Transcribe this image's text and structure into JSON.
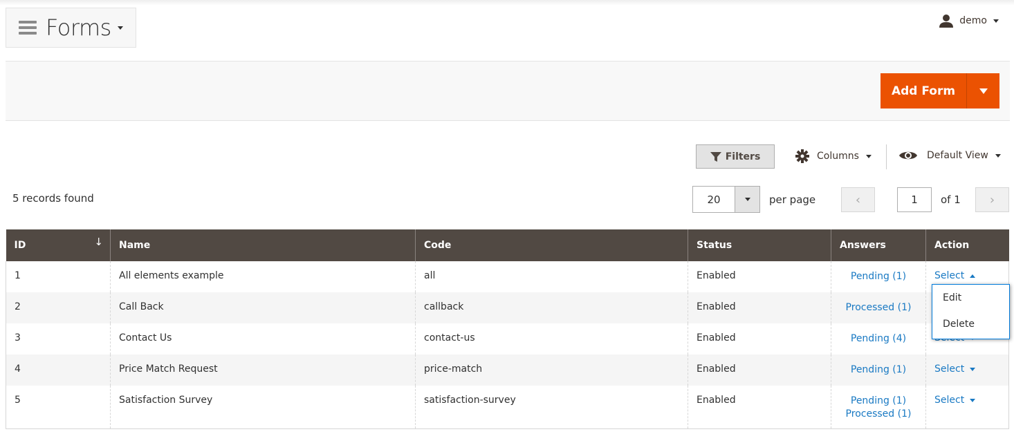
{
  "header": {
    "title": "Forms",
    "user": "demo"
  },
  "actions": {
    "add_label": "Add Form"
  },
  "toolbar": {
    "filters": "Filters",
    "columns": "Columns",
    "view": "Default View"
  },
  "grid": {
    "records_found": "5 records found",
    "per_page_value": "20",
    "per_page_label": "per page",
    "page": "1",
    "of_pages": "of 1",
    "columns": [
      "ID",
      "Name",
      "Code",
      "Status",
      "Answers",
      "Action"
    ],
    "sort_indicator": "↓",
    "rows": [
      {
        "id": "1",
        "name": "All elements example",
        "code": "all",
        "status": "Enabled",
        "answers": [
          "Pending (1)"
        ],
        "action": "Select",
        "open": true
      },
      {
        "id": "2",
        "name": "Call Back",
        "code": "callback",
        "status": "Enabled",
        "answers": [
          "Processed (1)"
        ],
        "action": "Select"
      },
      {
        "id": "3",
        "name": "Contact Us",
        "code": "contact-us",
        "status": "Enabled",
        "answers": [
          "Pending (4)"
        ],
        "action": "Select"
      },
      {
        "id": "4",
        "name": "Price Match Request",
        "code": "price-match",
        "status": "Enabled",
        "answers": [
          "Pending (1)"
        ],
        "action": "Select"
      },
      {
        "id": "5",
        "name": "Satisfaction Survey",
        "code": "satisfaction-survey",
        "status": "Enabled",
        "answers": [
          "Pending (1)",
          "Processed (1)"
        ],
        "action": "Select"
      }
    ],
    "action_menu": [
      "Edit",
      "Delete"
    ]
  },
  "colors": {
    "accent": "#eb5202",
    "header_bg": "#514943",
    "link": "#1979c3"
  }
}
